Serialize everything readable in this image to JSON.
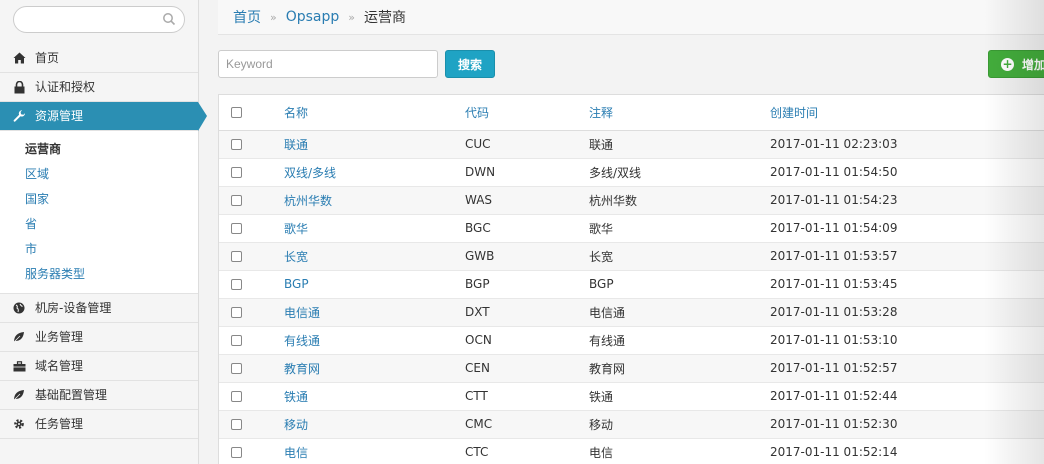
{
  "sidebar": {
    "search_placeholder": "",
    "items_top": [
      {
        "label": "首页",
        "icon": "home-icon"
      },
      {
        "label": "认证和授权",
        "icon": "lock-icon"
      },
      {
        "label": "资源管理",
        "icon": "wrench-icon",
        "active": true
      }
    ],
    "subitems": [
      {
        "label": "运营商",
        "current": true
      },
      {
        "label": "区域"
      },
      {
        "label": "国家"
      },
      {
        "label": "省"
      },
      {
        "label": "市"
      },
      {
        "label": "服务器类型"
      }
    ],
    "items_bottom": [
      {
        "label": "机房-设备管理",
        "icon": "globe-icon"
      },
      {
        "label": "业务管理",
        "icon": "leaf-icon"
      },
      {
        "label": "域名管理",
        "icon": "briefcase-icon"
      },
      {
        "label": "基础配置管理",
        "icon": "leaf-icon"
      },
      {
        "label": "任务管理",
        "icon": "gear-icon"
      }
    ]
  },
  "breadcrumb": {
    "home": "首页",
    "app": "Opsapp",
    "sep": "»",
    "current": "运营商"
  },
  "toolbar": {
    "keyword_placeholder": "Keyword",
    "search_label": "搜索",
    "add_label": "增加"
  },
  "table": {
    "headers": [
      "名称",
      "代码",
      "注释",
      "创建时间"
    ],
    "rows": [
      {
        "name": "联通",
        "code": "CUC",
        "note": "联通",
        "created": "2017-01-11 02:23:03"
      },
      {
        "name": "双线/多线",
        "code": "DWN",
        "note": "多线/双线",
        "created": "2017-01-11 01:54:50"
      },
      {
        "name": "杭州华数",
        "code": "WAS",
        "note": "杭州华数",
        "created": "2017-01-11 01:54:23"
      },
      {
        "name": "歌华",
        "code": "BGC",
        "note": "歌华",
        "created": "2017-01-11 01:54:09"
      },
      {
        "name": "长宽",
        "code": "GWB",
        "note": "长宽",
        "created": "2017-01-11 01:53:57"
      },
      {
        "name": "BGP",
        "code": "BGP",
        "note": "BGP",
        "created": "2017-01-11 01:53:45"
      },
      {
        "name": "电信通",
        "code": "DXT",
        "note": "电信通",
        "created": "2017-01-11 01:53:28"
      },
      {
        "name": "有线通",
        "code": "OCN",
        "note": "有线通",
        "created": "2017-01-11 01:53:10"
      },
      {
        "name": "教育网",
        "code": "CEN",
        "note": "教育网",
        "created": "2017-01-11 01:52:57"
      },
      {
        "name": "铁通",
        "code": "CTT",
        "note": "铁通",
        "created": "2017-01-11 01:52:44"
      },
      {
        "name": "移动",
        "code": "CMC",
        "note": "移动",
        "created": "2017-01-11 01:52:30"
      },
      {
        "name": "电信",
        "code": "CTC",
        "note": "电信",
        "created": "2017-01-11 01:52:14"
      }
    ]
  },
  "colors": {
    "accent": "#2b8fb3",
    "link": "#2a7db2",
    "search_button": "#1fa3c4",
    "add_button": "#43ad3c"
  }
}
